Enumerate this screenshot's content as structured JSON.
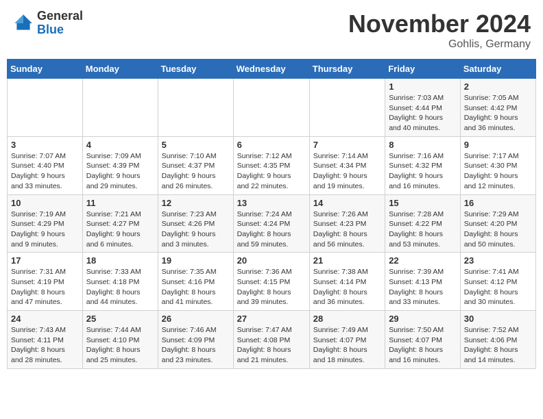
{
  "header": {
    "logo_general": "General",
    "logo_blue": "Blue",
    "title": "November 2024",
    "location": "Gohlis, Germany"
  },
  "weekdays": [
    "Sunday",
    "Monday",
    "Tuesday",
    "Wednesday",
    "Thursday",
    "Friday",
    "Saturday"
  ],
  "weeks": [
    [
      {
        "day": "",
        "info": ""
      },
      {
        "day": "",
        "info": ""
      },
      {
        "day": "",
        "info": ""
      },
      {
        "day": "",
        "info": ""
      },
      {
        "day": "",
        "info": ""
      },
      {
        "day": "1",
        "info": "Sunrise: 7:03 AM\nSunset: 4:44 PM\nDaylight: 9 hours\nand 40 minutes."
      },
      {
        "day": "2",
        "info": "Sunrise: 7:05 AM\nSunset: 4:42 PM\nDaylight: 9 hours\nand 36 minutes."
      }
    ],
    [
      {
        "day": "3",
        "info": "Sunrise: 7:07 AM\nSunset: 4:40 PM\nDaylight: 9 hours\nand 33 minutes."
      },
      {
        "day": "4",
        "info": "Sunrise: 7:09 AM\nSunset: 4:39 PM\nDaylight: 9 hours\nand 29 minutes."
      },
      {
        "day": "5",
        "info": "Sunrise: 7:10 AM\nSunset: 4:37 PM\nDaylight: 9 hours\nand 26 minutes."
      },
      {
        "day": "6",
        "info": "Sunrise: 7:12 AM\nSunset: 4:35 PM\nDaylight: 9 hours\nand 22 minutes."
      },
      {
        "day": "7",
        "info": "Sunrise: 7:14 AM\nSunset: 4:34 PM\nDaylight: 9 hours\nand 19 minutes."
      },
      {
        "day": "8",
        "info": "Sunrise: 7:16 AM\nSunset: 4:32 PM\nDaylight: 9 hours\nand 16 minutes."
      },
      {
        "day": "9",
        "info": "Sunrise: 7:17 AM\nSunset: 4:30 PM\nDaylight: 9 hours\nand 12 minutes."
      }
    ],
    [
      {
        "day": "10",
        "info": "Sunrise: 7:19 AM\nSunset: 4:29 PM\nDaylight: 9 hours\nand 9 minutes."
      },
      {
        "day": "11",
        "info": "Sunrise: 7:21 AM\nSunset: 4:27 PM\nDaylight: 9 hours\nand 6 minutes."
      },
      {
        "day": "12",
        "info": "Sunrise: 7:23 AM\nSunset: 4:26 PM\nDaylight: 9 hours\nand 3 minutes."
      },
      {
        "day": "13",
        "info": "Sunrise: 7:24 AM\nSunset: 4:24 PM\nDaylight: 8 hours\nand 59 minutes."
      },
      {
        "day": "14",
        "info": "Sunrise: 7:26 AM\nSunset: 4:23 PM\nDaylight: 8 hours\nand 56 minutes."
      },
      {
        "day": "15",
        "info": "Sunrise: 7:28 AM\nSunset: 4:22 PM\nDaylight: 8 hours\nand 53 minutes."
      },
      {
        "day": "16",
        "info": "Sunrise: 7:29 AM\nSunset: 4:20 PM\nDaylight: 8 hours\nand 50 minutes."
      }
    ],
    [
      {
        "day": "17",
        "info": "Sunrise: 7:31 AM\nSunset: 4:19 PM\nDaylight: 8 hours\nand 47 minutes."
      },
      {
        "day": "18",
        "info": "Sunrise: 7:33 AM\nSunset: 4:18 PM\nDaylight: 8 hours\nand 44 minutes."
      },
      {
        "day": "19",
        "info": "Sunrise: 7:35 AM\nSunset: 4:16 PM\nDaylight: 8 hours\nand 41 minutes."
      },
      {
        "day": "20",
        "info": "Sunrise: 7:36 AM\nSunset: 4:15 PM\nDaylight: 8 hours\nand 39 minutes."
      },
      {
        "day": "21",
        "info": "Sunrise: 7:38 AM\nSunset: 4:14 PM\nDaylight: 8 hours\nand 36 minutes."
      },
      {
        "day": "22",
        "info": "Sunrise: 7:39 AM\nSunset: 4:13 PM\nDaylight: 8 hours\nand 33 minutes."
      },
      {
        "day": "23",
        "info": "Sunrise: 7:41 AM\nSunset: 4:12 PM\nDaylight: 8 hours\nand 30 minutes."
      }
    ],
    [
      {
        "day": "24",
        "info": "Sunrise: 7:43 AM\nSunset: 4:11 PM\nDaylight: 8 hours\nand 28 minutes."
      },
      {
        "day": "25",
        "info": "Sunrise: 7:44 AM\nSunset: 4:10 PM\nDaylight: 8 hours\nand 25 minutes."
      },
      {
        "day": "26",
        "info": "Sunrise: 7:46 AM\nSunset: 4:09 PM\nDaylight: 8 hours\nand 23 minutes."
      },
      {
        "day": "27",
        "info": "Sunrise: 7:47 AM\nSunset: 4:08 PM\nDaylight: 8 hours\nand 21 minutes."
      },
      {
        "day": "28",
        "info": "Sunrise: 7:49 AM\nSunset: 4:07 PM\nDaylight: 8 hours\nand 18 minutes."
      },
      {
        "day": "29",
        "info": "Sunrise: 7:50 AM\nSunset: 4:07 PM\nDaylight: 8 hours\nand 16 minutes."
      },
      {
        "day": "30",
        "info": "Sunrise: 7:52 AM\nSunset: 4:06 PM\nDaylight: 8 hours\nand 14 minutes."
      }
    ]
  ]
}
